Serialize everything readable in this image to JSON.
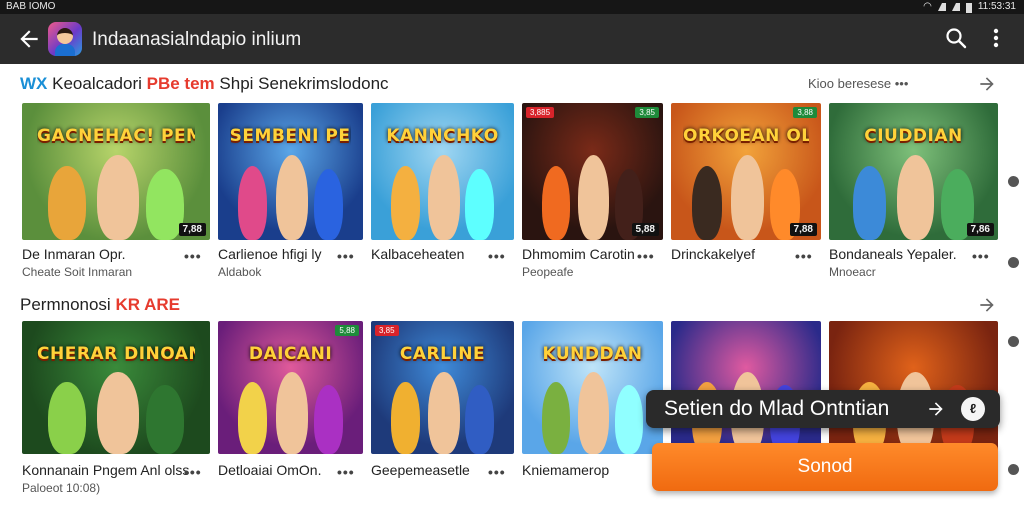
{
  "status_bar": {
    "left_text": "BAB IOMO",
    "right_text": "11:53:31"
  },
  "app_bar": {
    "title": "Indaanasialndapio inlium",
    "back_icon": "arrow-left-icon",
    "search_icon": "search-icon",
    "more_icon": "more-vert-icon"
  },
  "sections": [
    {
      "title_prefix": "WX",
      "title_main": "Keoalcadori",
      "title_hl": "PBe tem",
      "title_rest": "Shpi Senekrimslodonc",
      "see_more": "Kioo beresese •••",
      "items": [
        {
          "title": "De Inmaran Opr.",
          "subtitle": "Cheate Soit Inmaran",
          "logo": "GACNEHAC! PEMANC",
          "badge": "7,88",
          "badge_tl": "",
          "badge_tr": ""
        },
        {
          "title": "Carlienoe hfigi ly",
          "subtitle": "Aldabok",
          "logo": "SEMBENI PENEIN",
          "badge": "",
          "badge_tl": "",
          "badge_tr": ""
        },
        {
          "title": "Kalbaceheaten",
          "subtitle": "",
          "logo": "KANNCHKO",
          "badge": "",
          "badge_tl": "",
          "badge_tr": ""
        },
        {
          "title": "Dhmomim Carotin",
          "subtitle": "Peopeafe",
          "logo": "",
          "badge": "5,88",
          "badge_tl": "3,885",
          "badge_tr": "3,85"
        },
        {
          "title": "Drinckakelyef",
          "subtitle": "",
          "logo": "ORKOEAN OLDEAN",
          "badge": "7,88",
          "badge_tl": "",
          "badge_tr": "3,88"
        },
        {
          "title": "Bondaneals Yepaler.",
          "subtitle": "Mnoeacr",
          "logo": "CIUDDIAN",
          "badge": "7,86",
          "badge_tl": "",
          "badge_tr": ""
        }
      ]
    },
    {
      "title_main": "Permnonosi",
      "title_hl": "KR ARE",
      "items": [
        {
          "title": "Konnanain Pngem Anl olss",
          "subtitle": "Paloeot 10:08)",
          "logo": "CHERAR DINOAN",
          "badge": "",
          "badge_tl": "",
          "badge_tr": ""
        },
        {
          "title": "Detloaiai OmOn.",
          "subtitle": "",
          "logo": "DAICANI",
          "badge": "",
          "badge_tl": "",
          "badge_tr": "5,88"
        },
        {
          "title": "Geepemeasetle",
          "subtitle": "",
          "logo": "CARLINE",
          "badge": "",
          "badge_tl": "3,85",
          "badge_tr": ""
        },
        {
          "title": "Kniemamerop",
          "subtitle": "",
          "logo": "KUNDDAN",
          "badge": "",
          "badge_tl": "",
          "badge_tr": ""
        },
        {
          "title": "",
          "subtitle": "",
          "logo": "",
          "badge": "",
          "badge_tl": "",
          "badge_tr": ""
        },
        {
          "title": "",
          "subtitle": "",
          "logo": "",
          "badge": "",
          "badge_tl": "",
          "badge_tr": ""
        }
      ]
    }
  ],
  "tooltip": {
    "text": "Setien do Mlad Ontntian",
    "arrow_icon": "arrow-right-icon",
    "round_label": "ℓ"
  },
  "cta": {
    "label": "Sonod"
  },
  "colors": {
    "accent": "#f06a10",
    "appbar": "#2c2c2c",
    "highlight": "#e63b2e"
  }
}
